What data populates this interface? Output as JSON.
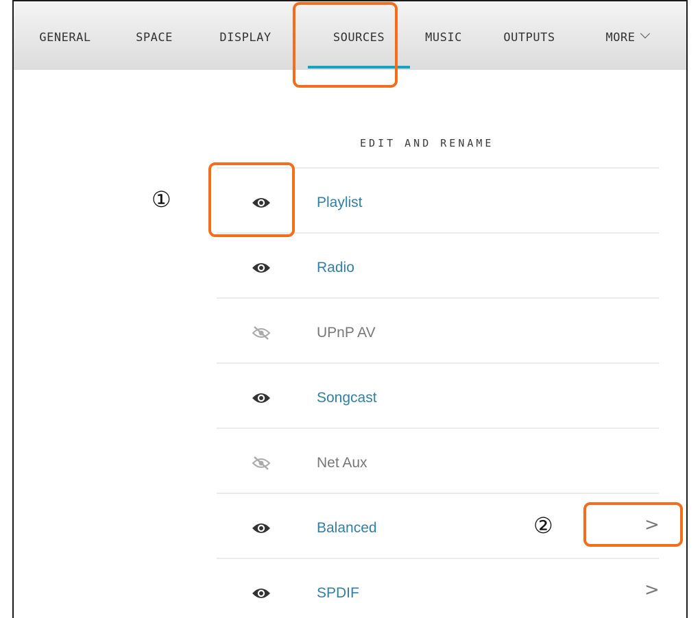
{
  "tabs": [
    {
      "label": "GENERAL"
    },
    {
      "label": "SPACE"
    },
    {
      "label": "DISPLAY"
    },
    {
      "label": "SOURCES",
      "active": true
    },
    {
      "label": "MUSIC"
    },
    {
      "label": "OUTPUTS"
    },
    {
      "label": "MORE"
    }
  ],
  "section_title": "EDIT AND RENAME",
  "sources": [
    {
      "label": "Playlist",
      "visible": true
    },
    {
      "label": "Radio",
      "visible": true
    },
    {
      "label": "UPnP AV",
      "visible": false
    },
    {
      "label": "Songcast",
      "visible": true
    },
    {
      "label": "Net Aux",
      "visible": false
    },
    {
      "label": "Balanced",
      "visible": true,
      "arrow": ">"
    },
    {
      "label": "SPDIF",
      "visible": true,
      "arrow": ">"
    }
  ],
  "annotations": {
    "one": "①",
    "two": "②"
  },
  "colors": {
    "accent": "#17a3bf",
    "highlight": "#f36d1a",
    "link": "#2f7fa8"
  }
}
